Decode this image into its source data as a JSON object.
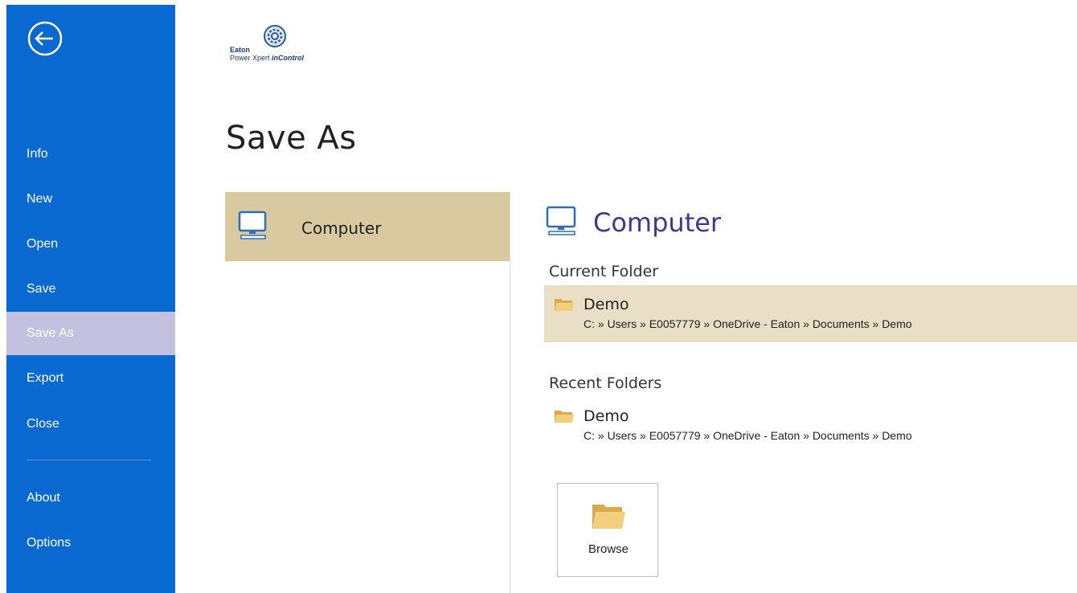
{
  "sidebar": {
    "items": [
      {
        "label": "Info"
      },
      {
        "label": "New"
      },
      {
        "label": "Open"
      },
      {
        "label": "Save"
      },
      {
        "label": "Save As",
        "selected": true
      },
      {
        "label": "Export"
      },
      {
        "label": "Close"
      },
      {
        "label": "About"
      },
      {
        "label": "Options"
      }
    ],
    "background_color": "#0969d0",
    "selected_color": "#c4c0e0"
  },
  "logo": {
    "line1": "Eaton",
    "line2_prefix": "Power Xpert ",
    "line2_emphasis": "inControl"
  },
  "page": {
    "title": "Save As"
  },
  "places": [
    {
      "label": "Computer",
      "icon": "computer-icon",
      "selected": true
    }
  ],
  "main": {
    "title": "Computer",
    "title_icon": "computer-icon",
    "current_folder_label": "Current Folder",
    "current_folder": {
      "name": "Demo",
      "path": "C: » Users » E0057779 » OneDrive - Eaton » Documents » Demo"
    },
    "recent_folders_label": "Recent Folders",
    "recent_folders": [
      {
        "name": "Demo",
        "path": "C: » Users » E0057779 » OneDrive - Eaton » Documents » Demo"
      }
    ],
    "browse_label": "Browse"
  },
  "colors": {
    "accent_title": "#3b3a8f",
    "place_selected": "#d8c9a0",
    "current_folder_bg": "#e8dfc6"
  }
}
